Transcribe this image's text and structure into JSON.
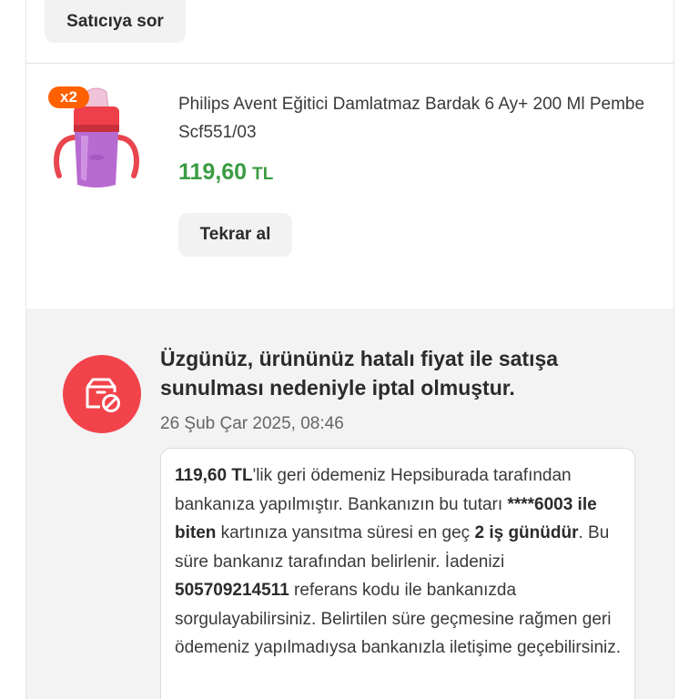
{
  "seller": {
    "ask_label": "Satıcıya sor"
  },
  "product": {
    "quantity_badge": "x2",
    "title": "Philips Avent Eğitici Damlatmaz Bardak 6 Ay+  200 Ml Pembe Scf551/03",
    "price": "119,60",
    "currency": "TL",
    "rebuy_label": "Tekrar al",
    "image_icon": "sippy-cup-image"
  },
  "cancellation": {
    "icon": "cancelled-box-icon",
    "title": "Üzgünüz, ürününüz hatalı fiyat ile satışa sunulması nedeniyle iptal olmuştur.",
    "date": "26 Şub Çar 2025, 08:46",
    "refund": {
      "amount": "119,60 TL",
      "t1": "'lik geri ödemeniz Hepsiburada tarafından bankanıza yapılmıştır. Bankanızın bu tutarı ",
      "card": "****6003 ile biten",
      "t2": " kartınıza yansıtma süresi en geç ",
      "days": "2 iş günüdür",
      "t3": ". Bu süre bankanız tarafından belirlenir. İadenizi ",
      "reference": "505709214511",
      "t4": " referans kodu ile bankanızda sorgulayabilirsiniz. Belirtilen süre geçmesine rağmen geri ödemeniz yapılmadıysa bankanızla iletişime geçebilirsiniz."
    }
  },
  "colors": {
    "brand": "#ff6000",
    "price": "#3a9c43",
    "cancel": "#f2434a",
    "panel": "#f3f3f3"
  }
}
